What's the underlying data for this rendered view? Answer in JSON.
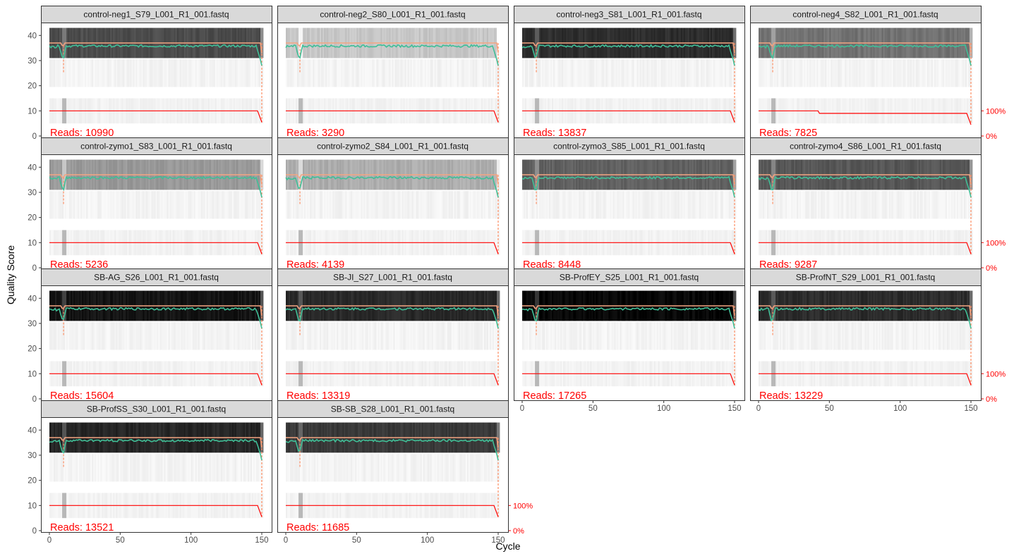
{
  "chart_data": {
    "type": "line",
    "xlabel": "Cycle",
    "ylabel": "Quality Score",
    "xlim": [
      0,
      151
    ],
    "ylim": [
      0,
      44
    ],
    "x_ticks": [
      0,
      50,
      100,
      150
    ],
    "y_ticks": [
      0,
      10,
      20,
      30,
      40
    ],
    "right_axis_labels": [
      "100%",
      "0%"
    ],
    "reads_prefix": "Reads: ",
    "colors": {
      "mean_quality": "#3fbf97",
      "median_quality": "#f4a582",
      "quartiles": "#fc8d62",
      "reads_fraction": "#ff0000",
      "heat_dark": "#000000",
      "heat_light": "#f2f2f2"
    },
    "panels": [
      {
        "title": "control-neg1_S79_L001_R1_001.fastq",
        "reads": 10990,
        "shade": 0.3
      },
      {
        "title": "control-neg2_S80_L001_R1_001.fastq",
        "reads": 3290,
        "shade": 0.78
      },
      {
        "title": "control-neg3_S81_L001_R1_001.fastq",
        "reads": 13837,
        "shade": 0.18
      },
      {
        "title": "control-neg4_S82_L001_R1_001.fastq",
        "reads": 7825,
        "shade": 0.45
      },
      {
        "title": "control-zymo1_S83_L001_R1_001.fastq",
        "reads": 5236,
        "shade": 0.6
      },
      {
        "title": "control-zymo2_S84_L001_R1_001.fastq",
        "reads": 4139,
        "shade": 0.68
      },
      {
        "title": "control-zymo3_S85_L001_R1_001.fastq",
        "reads": 8448,
        "shade": 0.38
      },
      {
        "title": "control-zymo4_S86_L001_R1_001.fastq",
        "reads": 9287,
        "shade": 0.34
      },
      {
        "title": "SB-AG_S26_L001_R1_001.fastq",
        "reads": 15604,
        "shade": 0.08
      },
      {
        "title": "SB-JI_S27_L001_R1_001.fastq",
        "reads": 13319,
        "shade": 0.16
      },
      {
        "title": "SB-ProfEY_S25_L001_R1_001.fastq",
        "reads": 17265,
        "shade": 0.03
      },
      {
        "title": "SB-ProfNT_S29_L001_R1_001.fastq",
        "reads": 13229,
        "shade": 0.17
      },
      {
        "title": "SB-ProfSS_S30_L001_R1_001.fastq",
        "reads": 13521,
        "shade": 0.15
      },
      {
        "title": "SB-SB_S28_L001_R1_001.fastq",
        "reads": 11685,
        "shade": 0.22
      }
    ],
    "reads_fraction_step": {
      "panel": "control-neg4_S82_L001_R1_001.fastq",
      "at_cycle": 43,
      "after_value": 9
    }
  }
}
